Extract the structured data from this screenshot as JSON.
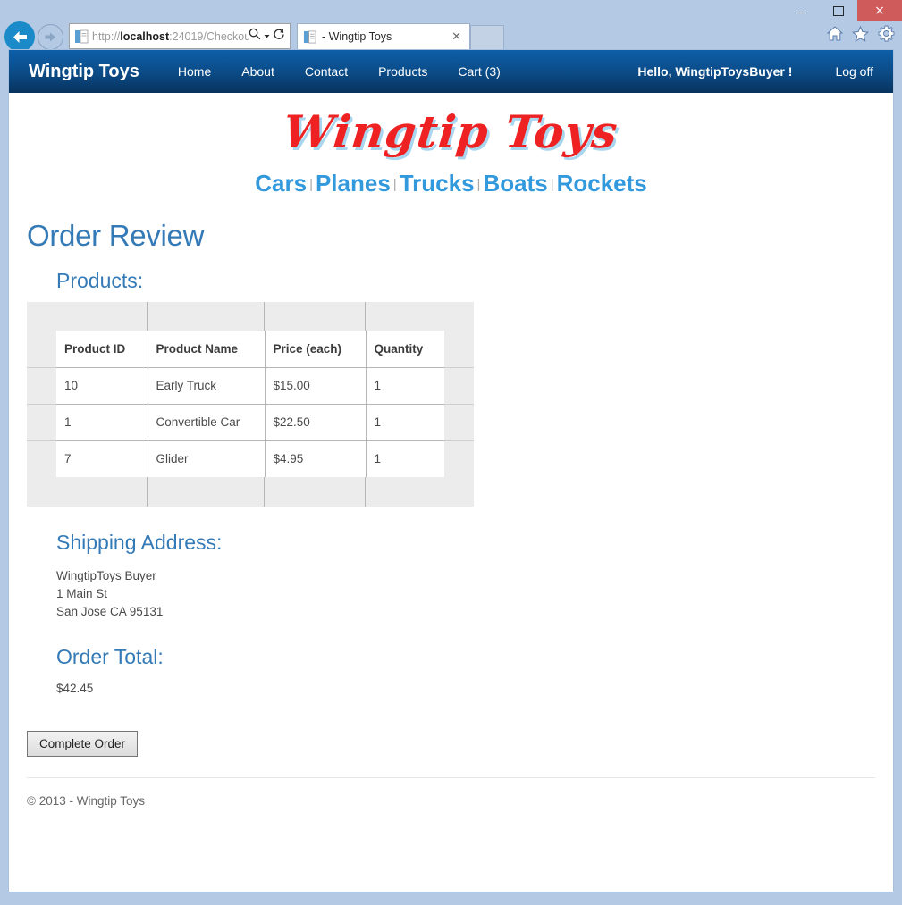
{
  "browser": {
    "window_controls": {
      "minimize": "minimize",
      "maximize": "maximize",
      "close": "×"
    },
    "toolbar_icons": [
      "home-icon",
      "favorites-star-icon",
      "tools-gear-icon"
    ],
    "back_label": "Back",
    "forward_label": "Forward",
    "address": {
      "scheme": "http://",
      "host": "localhost",
      "rest": ":24019/Checkou",
      "full": "http://localhost:24019/Checkou",
      "search_icon": "search-icon",
      "dropdown_icon": "chevron-down-icon",
      "refresh_icon": "refresh-icon"
    },
    "tab": {
      "title": "- Wingtip Toys",
      "close_label": "✕"
    },
    "new_tab_label": "New tab"
  },
  "site": {
    "brand": "Wingtip Toys",
    "nav_links": [
      {
        "label": "Home"
      },
      {
        "label": "About"
      },
      {
        "label": "Contact"
      },
      {
        "label": "Products"
      },
      {
        "label": "Cart (3)"
      }
    ],
    "greeting": "Hello, WingtipToysBuyer !",
    "logoff": "Log off",
    "logo_text": "Wingtip Toys",
    "categories": [
      {
        "label": "Cars"
      },
      {
        "label": "Planes"
      },
      {
        "label": "Trucks"
      },
      {
        "label": "Boats"
      },
      {
        "label": "Rockets"
      }
    ],
    "category_separator": "|"
  },
  "page": {
    "title": "Order Review",
    "products_heading": "Products:",
    "table": {
      "headers": [
        "Product ID",
        "Product Name",
        "Price (each)",
        "Quantity"
      ],
      "rows": [
        {
          "id": "10",
          "name": "Early Truck",
          "price": "$15.00",
          "qty": "1"
        },
        {
          "id": "1",
          "name": "Convertible Car",
          "price": "$22.50",
          "qty": "1"
        },
        {
          "id": "7",
          "name": "Glider",
          "price": "$4.95",
          "qty": "1"
        }
      ]
    },
    "shipping_heading": "Shipping Address:",
    "shipping_address": {
      "name": "WingtipToys Buyer",
      "street": "1 Main St",
      "city_state_zip": "San Jose CA 95131"
    },
    "total_heading": "Order Total:",
    "total_value": "$42.45",
    "complete_button": "Complete Order",
    "footer": "© 2013 - Wingtip Toys"
  },
  "colors": {
    "nav_blue_top": "#0e5fa8",
    "nav_blue_bottom": "#08335e",
    "heading_blue": "#337ab7",
    "category_blue": "#3399dd",
    "logo_red": "#ee2222",
    "logo_shadow": "#a8d6ef",
    "chrome_blue": "#b3c9e4",
    "close_red": "#d05b5b"
  }
}
